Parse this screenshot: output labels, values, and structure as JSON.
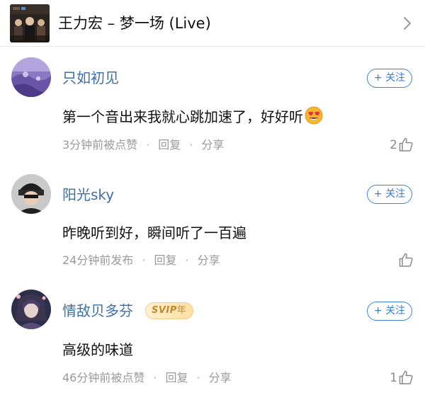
{
  "song": {
    "title": "王力宏 – 梦一场 (Live)",
    "art_icon": "album-cover-art",
    "chevron_icon": "chevron-right-icon"
  },
  "follow_label": "+ 关注",
  "actions": {
    "reply": "回复",
    "share": "分享",
    "separator": "·"
  },
  "comments": [
    {
      "username": "只如初见",
      "text": "第一个音出来我就心跳加速了，好好听",
      "emoji": "heart-eyes-emoji",
      "time": "3分钟前被点赞",
      "likes": "2"
    },
    {
      "username": "阳光sky",
      "text": "昨晚听到好，瞬间听了一百遍",
      "time": "24分钟前发布",
      "likes": ""
    },
    {
      "username": "情敌贝多芬",
      "badge_main": "SVIP",
      "badge_suffix": "年",
      "text": "高级的味道",
      "time": "46分钟前被点赞",
      "likes": "1"
    }
  ],
  "colors": {
    "username": "#3e6fa6",
    "follow_accent": "#2f7fd6",
    "meta_gray": "#9a9a9a",
    "badge_gold": "#c08a2c"
  }
}
